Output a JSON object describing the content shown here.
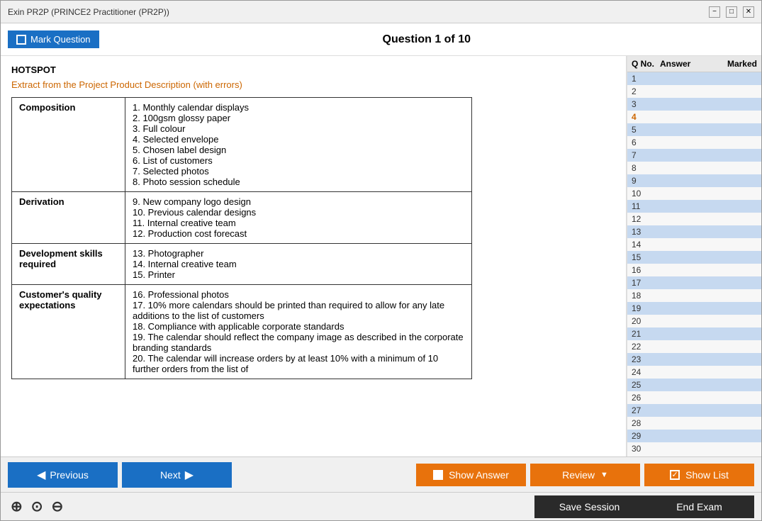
{
  "window": {
    "title": "Exin PR2P (PRINCE2 Practitioner (PR2P))"
  },
  "toolbar": {
    "mark_question_label": "Mark Question",
    "question_title": "Question 1 of 10"
  },
  "question": {
    "type_label": "HOTSPOT",
    "extract_label": "Extract from the Project Product Description (with errors)",
    "table": {
      "rows": [
        {
          "category": "Composition",
          "items": "1. Monthly calendar displays\n2. 100gsm glossy paper\n3. Full colour\n4. Selected envelope\n5. Chosen label design\n6. List of customers\n7. Selected photos\n8. Photo session schedule"
        },
        {
          "category": "Derivation",
          "items": "9. New company logo design\n10. Previous calendar designs\n11. Internal creative team\n12. Production cost forecast"
        },
        {
          "category": "Development skills required",
          "items": "13. Photographer\n14. Internal creative team\n15. Printer"
        },
        {
          "category": "Customer's quality expectations",
          "items": "16. Professional photos\n17. 10% more calendars should be printed than required to allow for any late additions to the list of customers\n18. Compliance with applicable corporate standards\n19. The calendar should reflect the company image as described in the corporate branding standards\n20. The calendar will increase orders by at least 10% with a minimum of 10 further orders from the list of"
        }
      ]
    }
  },
  "sidebar": {
    "headers": {
      "q_no": "Q No.",
      "answer": "Answer",
      "marked": "Marked"
    },
    "questions": [
      {
        "num": 1,
        "answer": "",
        "marked": ""
      },
      {
        "num": 2,
        "answer": "",
        "marked": ""
      },
      {
        "num": 3,
        "answer": "",
        "marked": ""
      },
      {
        "num": 4,
        "answer": "",
        "marked": "",
        "active": true
      },
      {
        "num": 5,
        "answer": "",
        "marked": ""
      },
      {
        "num": 6,
        "answer": "",
        "marked": ""
      },
      {
        "num": 7,
        "answer": "",
        "marked": ""
      },
      {
        "num": 8,
        "answer": "",
        "marked": ""
      },
      {
        "num": 9,
        "answer": "",
        "marked": ""
      },
      {
        "num": 10,
        "answer": "",
        "marked": ""
      },
      {
        "num": 11,
        "answer": "",
        "marked": ""
      },
      {
        "num": 12,
        "answer": "",
        "marked": ""
      },
      {
        "num": 13,
        "answer": "",
        "marked": ""
      },
      {
        "num": 14,
        "answer": "",
        "marked": ""
      },
      {
        "num": 15,
        "answer": "",
        "marked": ""
      },
      {
        "num": 16,
        "answer": "",
        "marked": ""
      },
      {
        "num": 17,
        "answer": "",
        "marked": ""
      },
      {
        "num": 18,
        "answer": "",
        "marked": ""
      },
      {
        "num": 19,
        "answer": "",
        "marked": ""
      },
      {
        "num": 20,
        "answer": "",
        "marked": ""
      },
      {
        "num": 21,
        "answer": "",
        "marked": ""
      },
      {
        "num": 22,
        "answer": "",
        "marked": ""
      },
      {
        "num": 23,
        "answer": "",
        "marked": ""
      },
      {
        "num": 24,
        "answer": "",
        "marked": ""
      },
      {
        "num": 25,
        "answer": "",
        "marked": ""
      },
      {
        "num": 26,
        "answer": "",
        "marked": ""
      },
      {
        "num": 27,
        "answer": "",
        "marked": ""
      },
      {
        "num": 28,
        "answer": "",
        "marked": ""
      },
      {
        "num": 29,
        "answer": "",
        "marked": ""
      },
      {
        "num": 30,
        "answer": "",
        "marked": ""
      }
    ]
  },
  "bottom_bar": {
    "prev_label": "Previous",
    "next_label": "Next",
    "show_answer_label": "Show Answer",
    "review_label": "Review",
    "show_list_label": "Show List"
  },
  "footer": {
    "zoom_in_icon": "+",
    "zoom_reset_icon": "⊙",
    "zoom_out_icon": "−",
    "save_session_label": "Save Session",
    "end_exam_label": "End Exam"
  },
  "colors": {
    "blue_btn": "#1a6fc4",
    "orange_btn": "#e8720c",
    "dark_btn": "#2a2a2a",
    "active_q": "#cc6600",
    "highlight_row": "#c6d9f0"
  }
}
